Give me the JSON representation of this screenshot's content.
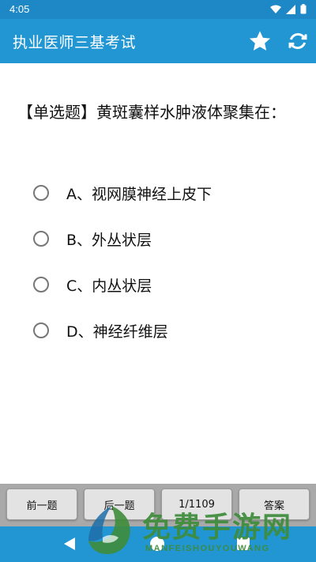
{
  "status_bar": {
    "time": "4:05",
    "icons": [
      "wifi-icon",
      "signal-icon",
      "battery-icon"
    ]
  },
  "app_bar": {
    "title": "执业医师三基考试",
    "actions": [
      "star-icon",
      "refresh-icon"
    ]
  },
  "question": {
    "text": "【单选题】黄斑囊样水肿液体聚集在："
  },
  "options": [
    {
      "label": "A、视网膜神经上皮下"
    },
    {
      "label": "B、外丛状层"
    },
    {
      "label": "C、内丛状层"
    },
    {
      "label": "D、神经纤维层"
    }
  ],
  "buttons": {
    "prev": "前一题",
    "next": "后一题",
    "counter": "1/1109",
    "answer": "答案"
  },
  "watermark": {
    "title": "免费手游网",
    "subtitle": "MANFEISHOUYOUWANG"
  },
  "colors": {
    "primary": "#2196d3",
    "status": "#1e88c7",
    "button_bar": "#a9a9a9",
    "watermark": "#3e8c3a"
  }
}
